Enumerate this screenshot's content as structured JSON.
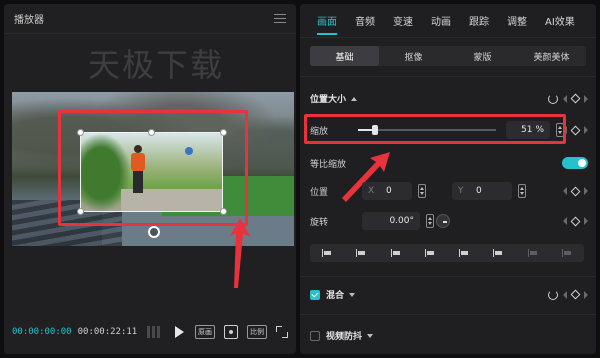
{
  "player": {
    "title": "播放器",
    "watermark": "天极下载",
    "timecode_current": "00:00:00:00",
    "timecode_total": "00:00:22:11",
    "ratio_label": "比例",
    "original_label": "原画"
  },
  "inspector": {
    "tabs": [
      "画面",
      "音频",
      "变速",
      "动画",
      "跟踪",
      "调整",
      "AI效果"
    ],
    "active_tab": "画面",
    "subtabs": [
      "基础",
      "抠像",
      "蒙版",
      "美颜美体"
    ],
    "active_subtab": "基础",
    "position_size": {
      "title": "位置大小",
      "scale_label": "缩放",
      "scale_value": "51",
      "scale_unit": "%",
      "scale_fraction": 0.12,
      "uniform_scale_label": "等比缩放",
      "uniform_scale_on": true,
      "position_label": "位置",
      "x_label": "X",
      "x_value": "0",
      "y_label": "Y",
      "y_value": "0",
      "rotation_label": "旋转",
      "rotation_value": "0.00°"
    },
    "blend": {
      "label": "混合",
      "enabled": true
    },
    "stabilize": {
      "label": "视频防抖",
      "enabled": false
    }
  },
  "colors": {
    "accent": "#23c2cc",
    "annotation_red": "#e8323c",
    "panel_bg": "#202022"
  }
}
